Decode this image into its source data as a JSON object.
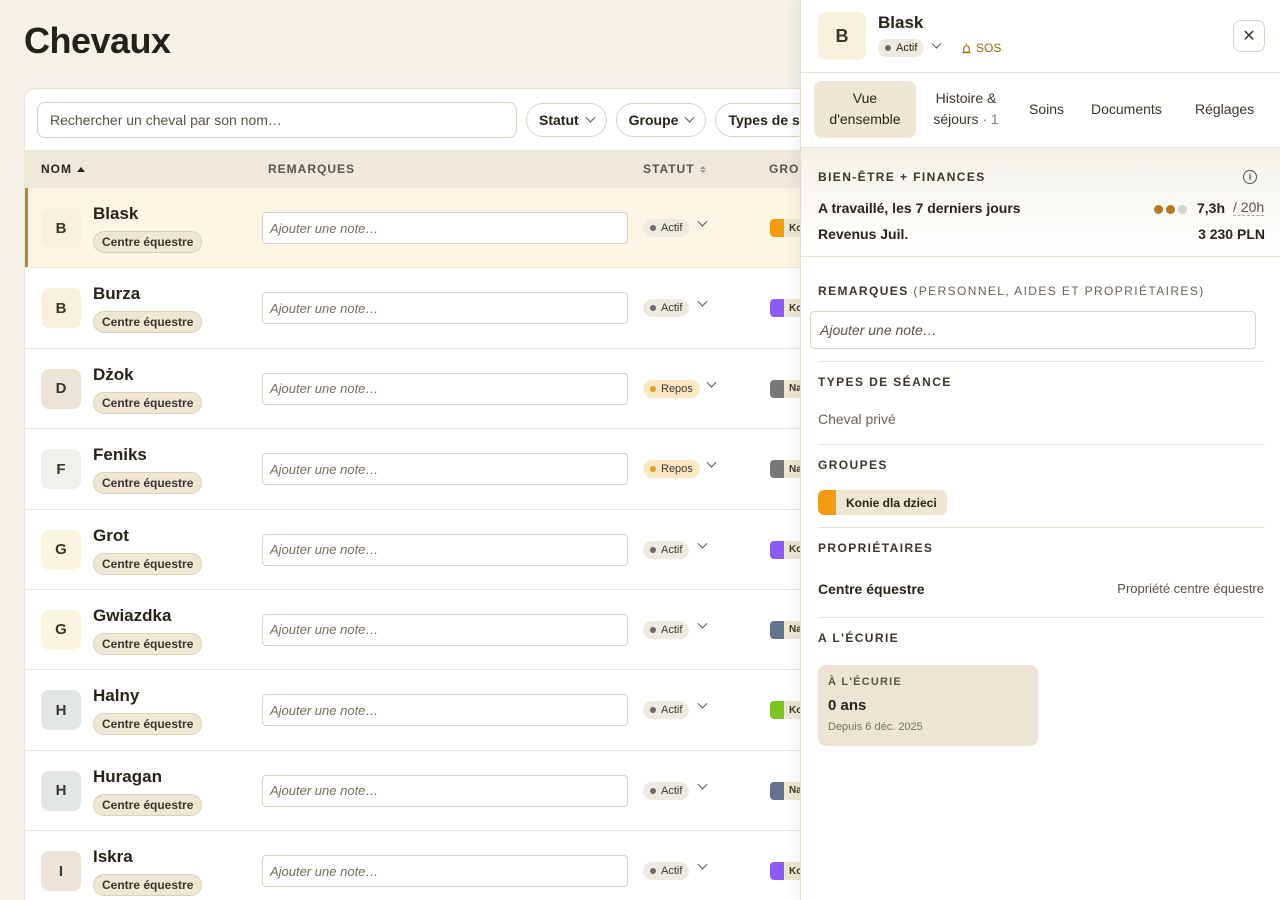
{
  "page": {
    "title": "Chevaux"
  },
  "toolbar": {
    "search_placeholder": "Rechercher un cheval par son nom…",
    "filters": [
      "Statut",
      "Groupe",
      "Types de s"
    ]
  },
  "table": {
    "columns": {
      "nom": "NOM",
      "remarques": "REMARQUES",
      "statut": "STATUT",
      "groupe": "GROU"
    },
    "rows": [
      {
        "initial": "B",
        "name": "Blask",
        "owner": "Centre équestre",
        "note_placeholder": "Ajouter une note…",
        "status": "Actif",
        "status_type": "actif",
        "group_label": "Ko",
        "group_color": "#f39c12",
        "avatar_bg": "#f9f1e0"
      },
      {
        "initial": "B",
        "name": "Burza",
        "owner": "Centre équestre",
        "note_placeholder": "Ajouter une note…",
        "status": "Actif",
        "status_type": "actif",
        "group_label": "Ko",
        "group_color": "#8b5cf6",
        "avatar_bg": "#f9f1e0"
      },
      {
        "initial": "D",
        "name": "Dżok",
        "owner": "Centre équestre",
        "note_placeholder": "Ajouter une note…",
        "status": "Repos",
        "status_type": "repos",
        "group_label": "Na",
        "group_color": "#777777",
        "avatar_bg": "#ece4d6"
      },
      {
        "initial": "F",
        "name": "Feniks",
        "owner": "Centre équestre",
        "note_placeholder": "Ajouter une note…",
        "status": "Repos",
        "status_type": "repos",
        "group_label": "Na",
        "group_color": "#777777",
        "avatar_bg": "#eef0ea"
      },
      {
        "initial": "G",
        "name": "Grot",
        "owner": "Centre équestre",
        "note_placeholder": "Ajouter une note…",
        "status": "Actif",
        "status_type": "actif",
        "group_label": "Ko",
        "group_color": "#8b5cf6",
        "avatar_bg": "#fbf5e4"
      },
      {
        "initial": "G",
        "name": "Gwiazdka",
        "owner": "Centre équestre",
        "note_placeholder": "Ajouter une note…",
        "status": "Actif",
        "status_type": "actif",
        "group_label": "Na",
        "group_color": "#64748b",
        "avatar_bg": "#fbf5e4"
      },
      {
        "initial": "H",
        "name": "Halny",
        "owner": "Centre équestre",
        "note_placeholder": "Ajouter une note…",
        "status": "Actif",
        "status_type": "actif",
        "group_label": "Ko",
        "group_color": "#7cc421",
        "avatar_bg": "#e3e6e6"
      },
      {
        "initial": "H",
        "name": "Huragan",
        "owner": "Centre équestre",
        "note_placeholder": "Ajouter une note…",
        "status": "Actif",
        "status_type": "actif",
        "group_label": "Na",
        "group_color": "#64748b",
        "avatar_bg": "#e3e6e6"
      },
      {
        "initial": "I",
        "name": "Iskra",
        "owner": "Centre équestre",
        "note_placeholder": "Ajouter une note…",
        "status": "Actif",
        "status_type": "actif",
        "group_label": "Ko",
        "group_color": "#8b5cf6",
        "avatar_bg": "#ece4d6"
      }
    ]
  },
  "panel": {
    "initial": "B",
    "name": "Blask",
    "status": "Actif",
    "sos": "SOS",
    "close": "✕",
    "tabs": {
      "overview_l1": "Vue",
      "overview_l2": "d'ensemble",
      "history_l1": "Histoire &",
      "history_l2": "séjours",
      "history_count": "· 1",
      "care": "Soins",
      "documents": "Documents",
      "settings": "Réglages"
    },
    "wellbeing": {
      "title": "BIEN-ÊTRE + FINANCES",
      "worked_label": "A travaillé, les 7 derniers jours",
      "worked_value": "7,3h",
      "worked_of": "/ 20h",
      "revenue_label": "Revenus Juil.",
      "revenue_value": "3 230 PLN",
      "dot_colors": [
        "#b07a1e",
        "#b07a1e",
        "#d8d2c6"
      ]
    },
    "remarks": {
      "title": "REMARQUES",
      "subtitle": "(PERSONNEL, AIDES ET PROPRIÉTAIRES)",
      "placeholder": "Ajouter une note…"
    },
    "session_types": {
      "title": "TYPES DE SÉANCE",
      "value": "Cheval privé"
    },
    "groups": {
      "title": "GROUPES",
      "item": "Konie dla dzieci"
    },
    "owners": {
      "title": "PROPRIÉTAIRES",
      "name": "Centre équestre",
      "detail": "Propriété centre équestre"
    },
    "stable": {
      "title": "A L'ÉCURIE",
      "card_caption": "À L'ÉCURIE",
      "card_value": "0 ans",
      "card_since": "Depuis 6 déc. 2025"
    }
  }
}
